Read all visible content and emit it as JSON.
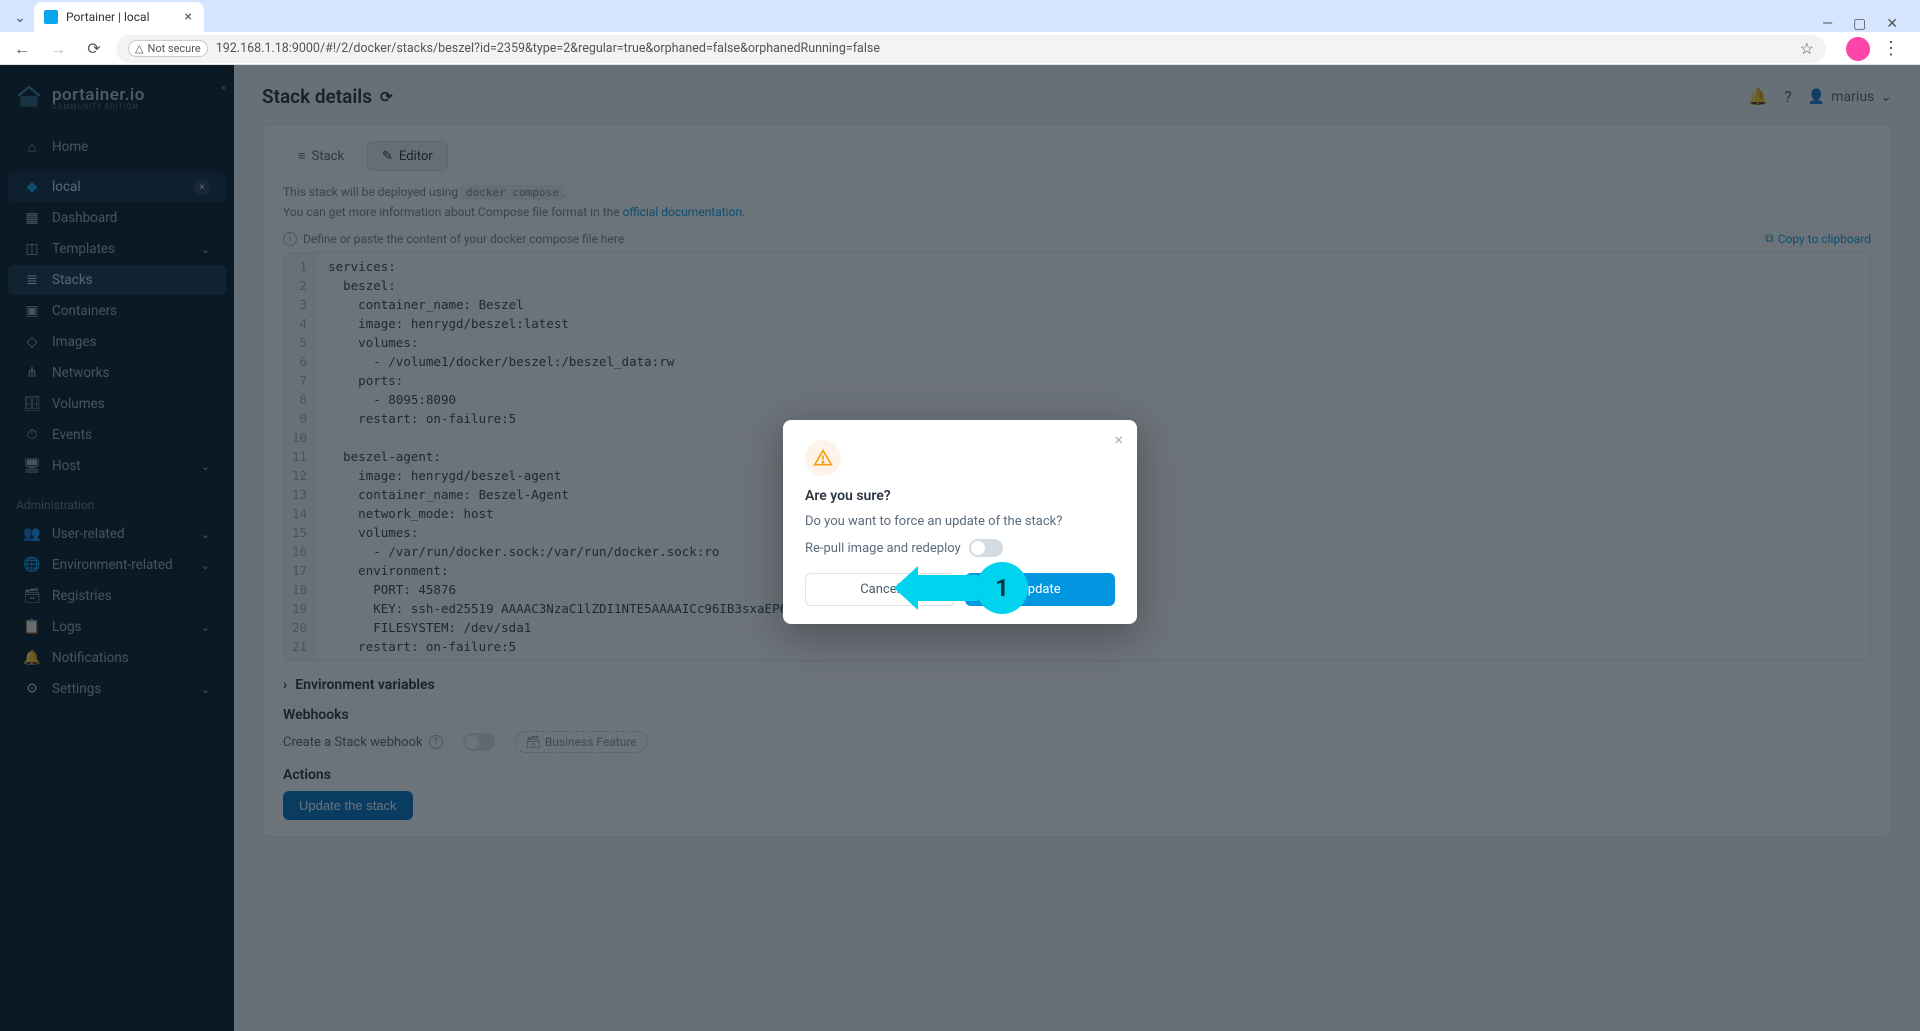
{
  "browser": {
    "tab_title": "Portainer | local",
    "not_secure": "Not secure",
    "url": "192.168.1.18:9000/#!/2/docker/stacks/beszel?id=2359&type=2&regular=true&orphaned=false&orphanedRunning=false"
  },
  "sidebar": {
    "brand": "portainer.io",
    "brand_sub": "COMMUNITY EDITION",
    "home": "Home",
    "env": "local",
    "items": [
      {
        "label": "Dashboard"
      },
      {
        "label": "Templates",
        "chevron": true
      },
      {
        "label": "Stacks",
        "active": true
      },
      {
        "label": "Containers"
      },
      {
        "label": "Images"
      },
      {
        "label": "Networks"
      },
      {
        "label": "Volumes"
      },
      {
        "label": "Events"
      },
      {
        "label": "Host",
        "chevron": true
      }
    ],
    "admin_label": "Administration",
    "admin_items": [
      {
        "label": "User-related",
        "chevron": true
      },
      {
        "label": "Environment-related",
        "chevron": true
      },
      {
        "label": "Registries"
      },
      {
        "label": "Logs",
        "chevron": true
      },
      {
        "label": "Notifications"
      },
      {
        "label": "Settings",
        "chevron": true
      }
    ]
  },
  "header": {
    "title": "Stack details",
    "user": "marius"
  },
  "tabs": {
    "stack": "Stack",
    "editor": "Editor"
  },
  "notes": {
    "deploy_prefix": "This stack will be deployed using ",
    "deploy_code": "docker compose",
    "info_prefix": "You can get more information about Compose file format in the ",
    "info_link": "official documentation",
    "hint": "Define or paste the content of your docker compose file here",
    "copy": "Copy to clipboard"
  },
  "editor": {
    "lines": [
      "services:",
      "  beszel:",
      "    container_name: Beszel",
      "    image: henrygd/beszel:latest",
      "    volumes:",
      "      - /volume1/docker/beszel:/beszel_data:rw",
      "    ports:",
      "      - 8095:8090",
      "    restart: on-failure:5",
      "",
      "  beszel-agent:",
      "    image: henrygd/beszel-agent",
      "    container_name: Beszel-Agent",
      "    network_mode: host",
      "    volumes:",
      "      - /var/run/docker.sock:/var/run/docker.sock:ro",
      "    environment:",
      "      PORT: 45876",
      "      KEY: ssh-ed25519 AAAAC3NzaC1lZDI1NTE5AAAAICc96IB3sxaEP6t6mQCgU1CN6nUd3h1xLQMcI4c0Ns+f",
      "      FILESYSTEM: /dev/sda1",
      "    restart: on-failure:5"
    ]
  },
  "sections": {
    "env_vars": "Environment variables",
    "webhooks": "Webhooks",
    "webhook_create": "Create a Stack webhook",
    "biz_feature": "Business Feature",
    "actions": "Actions",
    "update_stack": "Update the stack"
  },
  "modal": {
    "title": "Are you sure?",
    "text": "Do you want to force an update of the stack?",
    "toggle_label": "Re-pull image and redeploy",
    "cancel": "Cancel",
    "update": "Update"
  },
  "callout": {
    "number": "1"
  }
}
